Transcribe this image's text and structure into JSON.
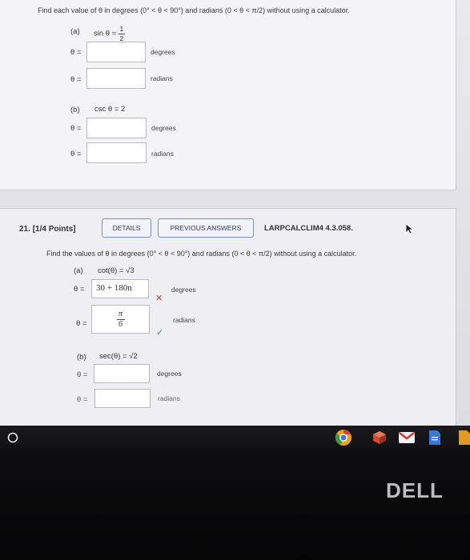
{
  "q20": {
    "instruction": "Find each value of θ in degrees (0° < θ < 90°) and radians (0 < θ < π/2) without using a calculator.",
    "a_label": "(a)",
    "a_eq_prefix": "sin θ =",
    "a_frac_num": "1",
    "a_frac_den": "2",
    "theta_eq": "θ =",
    "deg": "degrees",
    "rad": "radians",
    "b_label": "(b)",
    "b_eq": "csc θ = 2"
  },
  "q21": {
    "number": "21.",
    "points": "[1/4 Points]",
    "details_btn": "DETAILS",
    "prev_btn": "PREVIOUS ANSWERS",
    "code": "LARPCALCLIM4 4.3.058.",
    "instruction": "Find the values of θ in degrees (0° < θ < 90°) and radians (0 < θ < π/2) without using a calculator.",
    "a_label": "(a)",
    "a_eq": "cot(θ) = √3",
    "theta_eq": "θ =",
    "a_deg_answer": "30 + 180n",
    "a_rad_num": "π",
    "a_rad_den": "6",
    "deg": "degrees",
    "rad": "radians",
    "wrong_mark": "✕",
    "right_mark": "✓",
    "b_label": "(b)",
    "b_eq": "sec(θ) = √2"
  },
  "taskbar": {
    "launcher_icon": "circle-launcher-icon",
    "apps": [
      "chrome-icon",
      "app-cube-icon",
      "gmail-icon",
      "docs-icon",
      "slides-icon"
    ]
  },
  "brand": {
    "logo": "DELL"
  },
  "colors": {
    "wrong": "#d03434",
    "right": "#3f9b3f",
    "button_border": "#7c8fb8"
  }
}
